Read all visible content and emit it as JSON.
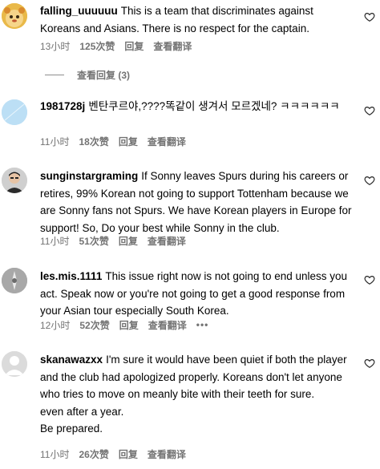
{
  "comments": [
    {
      "username": "falling_uuuuuu",
      "text": "This is a team that discriminates against Koreans and Asians. There is no respect for the captain.",
      "time": "13小时",
      "likes": "125次赞",
      "reply": "回复",
      "translate": "查看翻译"
    },
    {
      "username": "1981728j",
      "text": "벤탄쿠르야,????똑같이 생겨서 모르겠네? ㅋㅋㅋㅋㅋㅋ",
      "time": "11小时",
      "likes": "18次赞",
      "reply": "回复",
      "translate": "查看翻译"
    },
    {
      "username": "sunginstargraming",
      "text": "If Sonny leaves Spurs during his careers or retires, 99% Korean not going to support Tottenham because we are Sonny fans not Spurs. We have Korean players in Europe for support! So, Do your best while Sonny in the club.",
      "time": "11小时",
      "likes": "51次赞",
      "reply": "回复",
      "translate": "查看翻译"
    },
    {
      "username": "les.mis.1111",
      "text": "This issue right now is not going to end unless you act. Speak now or you're not going to get a good response from your Asian tour especially South Korea.",
      "time": "12小时",
      "likes": "52次赞",
      "reply": "回复",
      "translate": "查看翻译",
      "more": "•••"
    },
    {
      "username": "skanawazxx",
      "text": "I'm sure it would have been quiet if both the player and the club had apologized properly. Koreans don't let anyone who tries to move on meanly bite with their teeth for sure.",
      "text_line2": "even after a year.",
      "text_line3": "Be prepared.",
      "time": "11小时",
      "likes": "26次赞",
      "reply": "回复",
      "translate": "查看翻译"
    }
  ],
  "view_replies": "查看回复 (3)",
  "colors": {
    "meta_gray": "#737373",
    "text": "#000000",
    "background": "#ffffff"
  }
}
